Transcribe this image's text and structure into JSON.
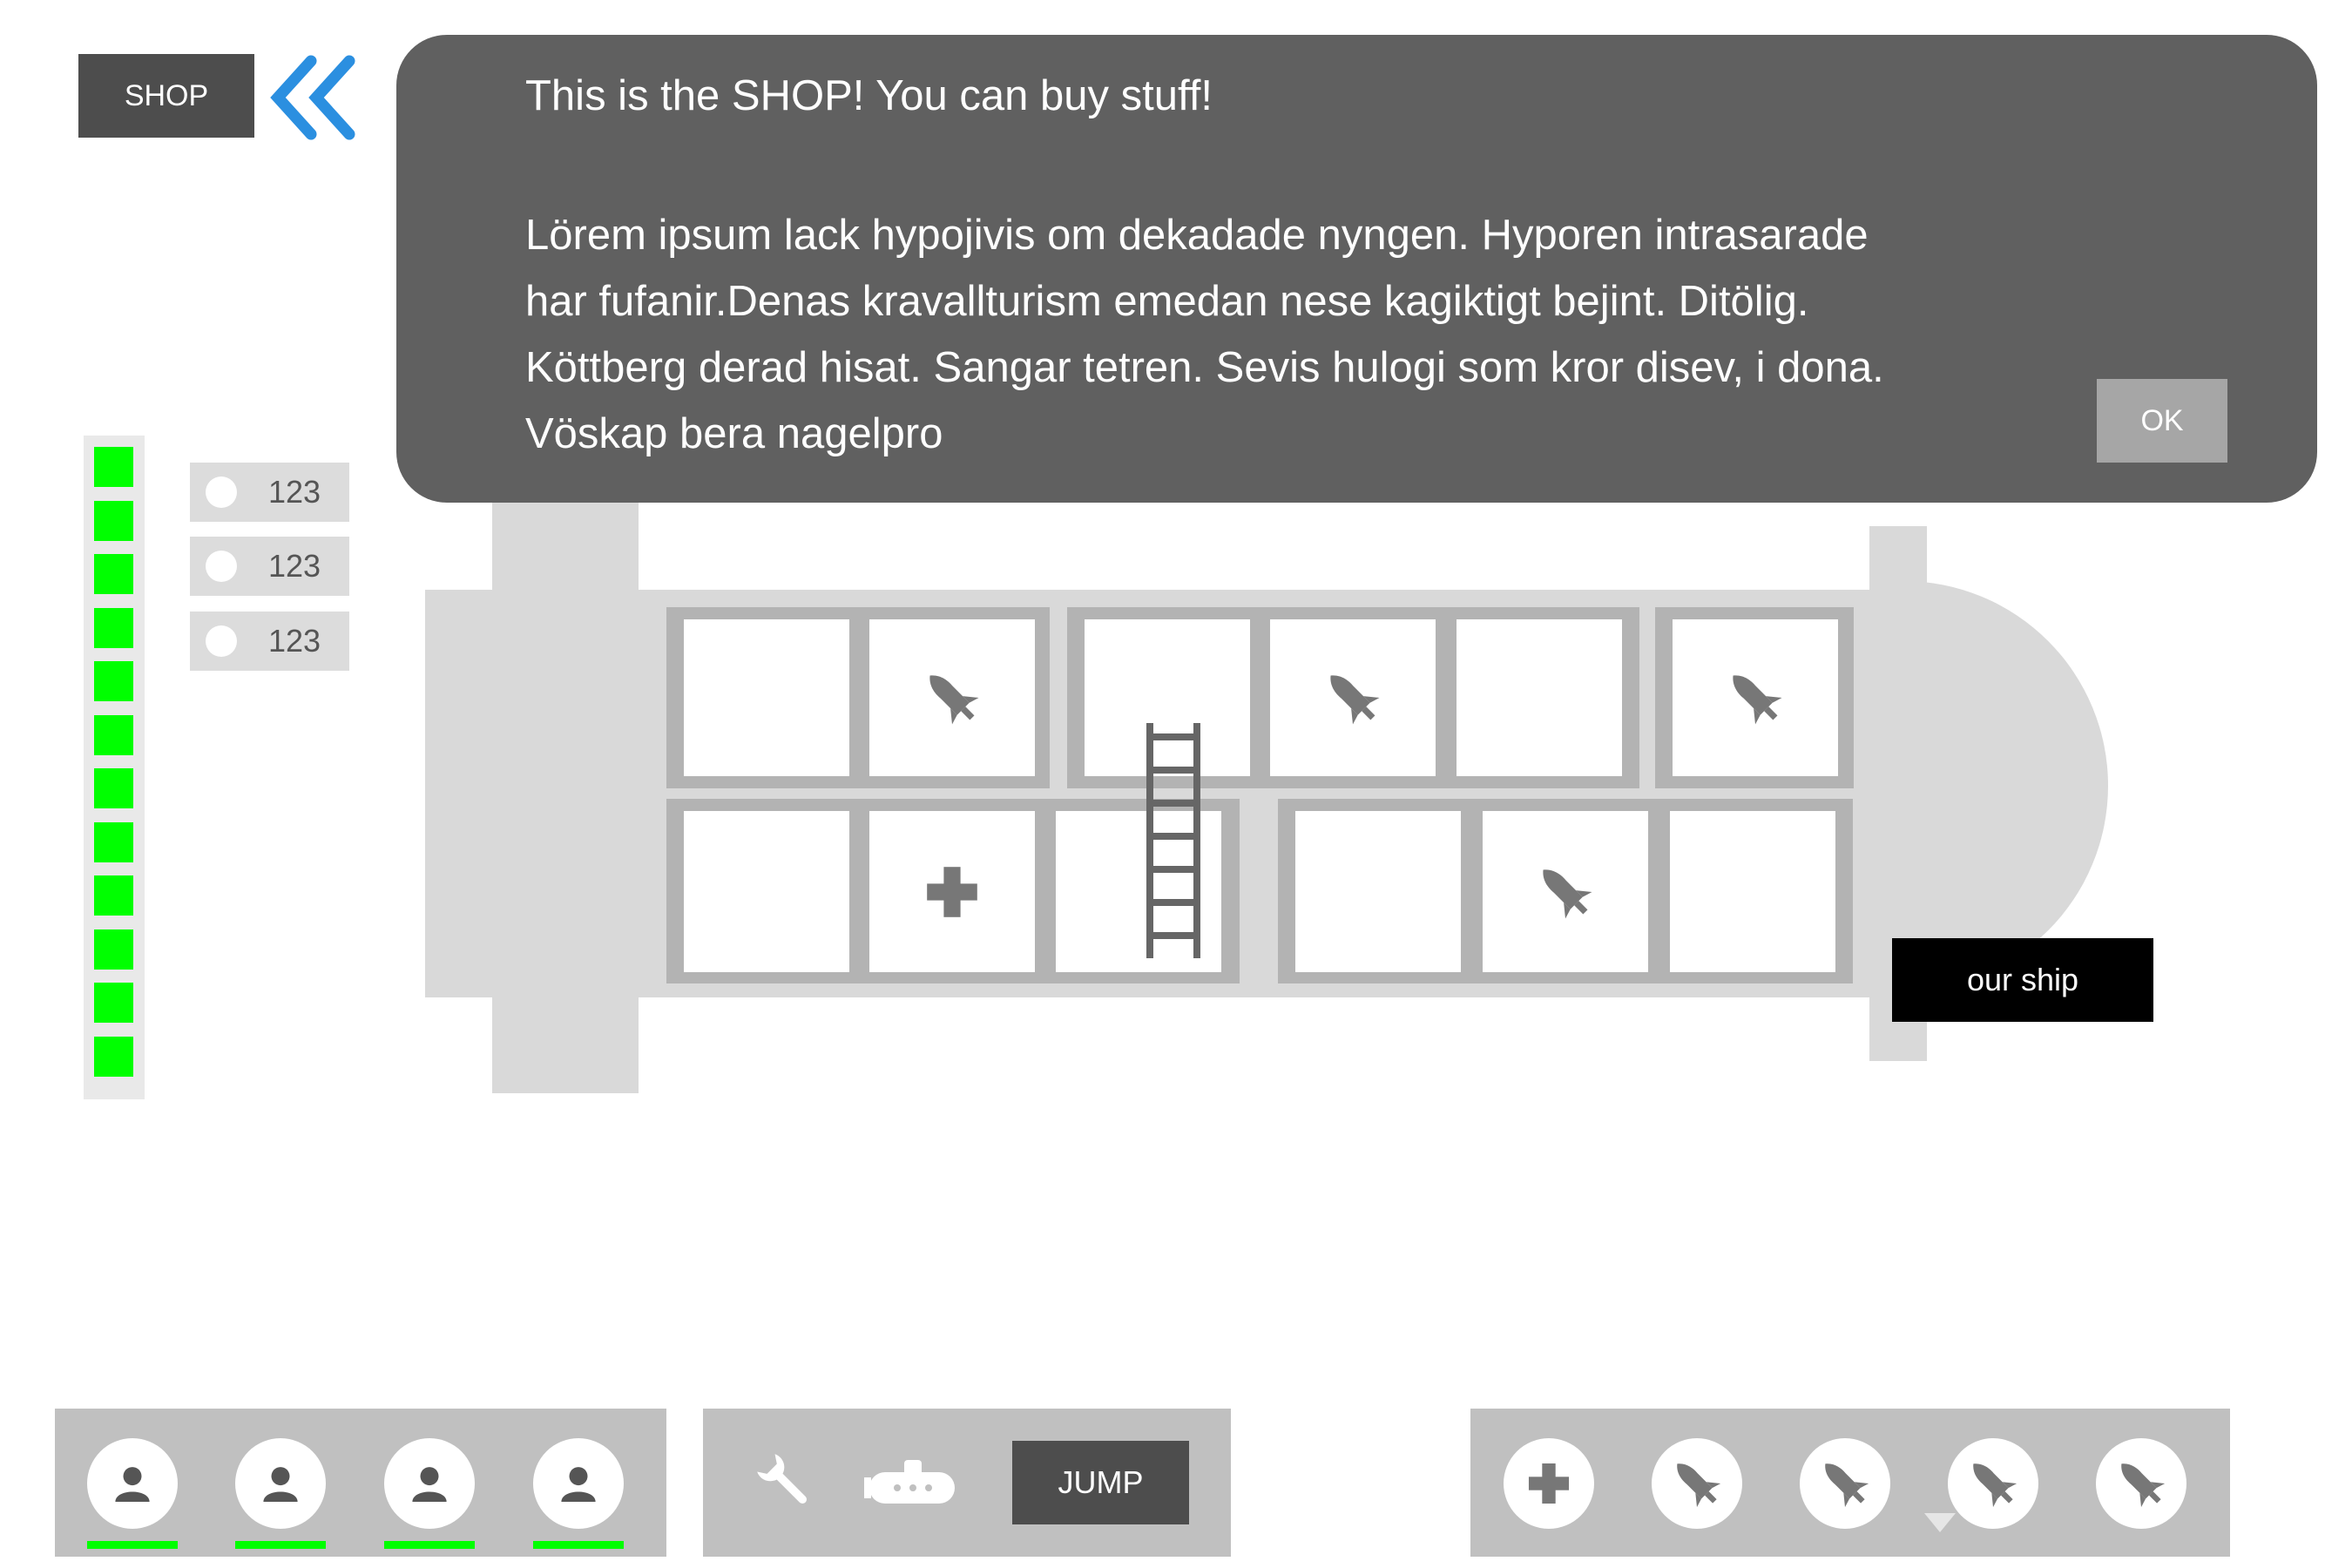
{
  "shop_button": "SHOP",
  "popup": {
    "title": "This is the SHOP! You can buy stuff!",
    "body": "Lörem ipsum lack hypojivis om dekadade nyngen. Hyporen intrasarade\nhar fufanir.Denas kravallturism emedan nese kagiktigt bejint. Ditölig.\nKöttberg derad hisat. Sangar tetren. Sevis hulogi som kror disev, i dona.\nVöskap bera nagelpro",
    "ok_label": "OK"
  },
  "health": {
    "segments": 12,
    "color": "#00ff00"
  },
  "resources": [
    {
      "label": "123"
    },
    {
      "label": "123"
    },
    {
      "label": "123"
    }
  ],
  "ship": {
    "label": "our ship",
    "rooms": {
      "top": [
        "empty",
        "missile-icon",
        "empty",
        "missile-icon",
        "empty",
        "missile-icon"
      ],
      "bottom": [
        "empty",
        "medical-plus-icon",
        "empty",
        "empty",
        "missile-icon",
        "empty"
      ]
    }
  },
  "crew": {
    "count": 4,
    "bar_color": "#00ff00"
  },
  "actions": {
    "jump_label": "JUMP",
    "icons": [
      "wrench-icon",
      "submarine-icon"
    ]
  },
  "inventory": [
    "medical-plus-icon",
    "missile-icon",
    "missile-icon",
    "missile-icon",
    "missile-icon"
  ],
  "colors": {
    "accent_blue": "#2b8fe0",
    "popup_bg": "#606060",
    "dark_button": "#4d4d4d"
  }
}
